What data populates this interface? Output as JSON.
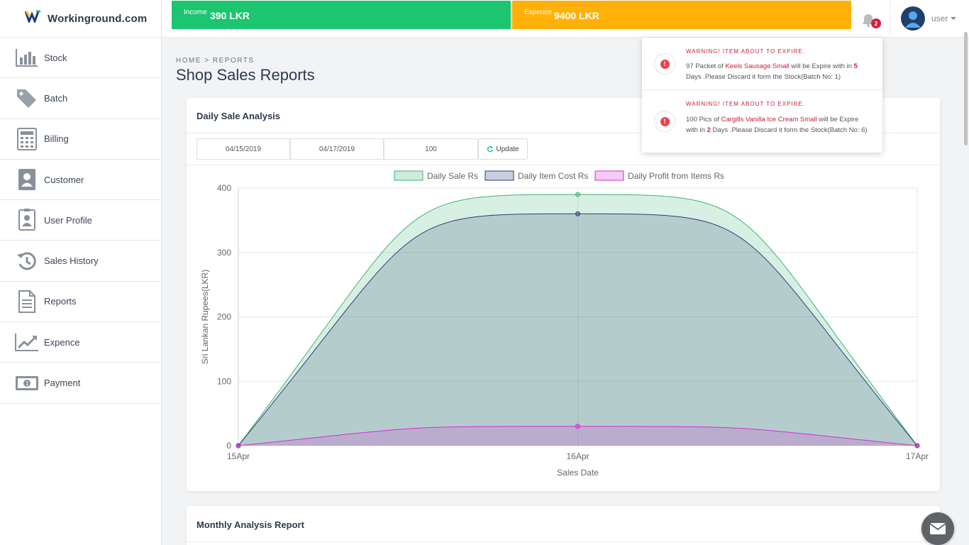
{
  "brand": {
    "name": "Workinground.com"
  },
  "sidebar": {
    "items": [
      {
        "label": "Stock",
        "icon": "bar-chart-icon"
      },
      {
        "label": "Batch",
        "icon": "tags-icon"
      },
      {
        "label": "Billing",
        "icon": "calculator-icon"
      },
      {
        "label": "Customer",
        "icon": "contact-card-icon"
      },
      {
        "label": "User Profile",
        "icon": "id-badge-icon"
      },
      {
        "label": "Sales History",
        "icon": "history-icon"
      },
      {
        "label": "Reports",
        "icon": "document-icon"
      },
      {
        "label": "Expence",
        "icon": "line-chart-icon"
      },
      {
        "label": "Payment",
        "icon": "money-icon"
      }
    ]
  },
  "topbar": {
    "income_label": "Income",
    "income_value": "390 LKR",
    "expence_label": "Expence",
    "expence_value": "9400 LKR",
    "notification_count": "2",
    "user_label": "user",
    "colors": {
      "income": "#1cc56f",
      "expence": "#ffb10a",
      "badge": "#d0213d"
    }
  },
  "breadcrumb": "HOME > REPORTS",
  "page_title": "Shop Sales Reports",
  "daily_card": {
    "title": "Daily Sale Analysis",
    "date_from": "04/15/2019",
    "date_to": "04/17/2019",
    "limit": "100",
    "update_label": "Update"
  },
  "monthly_card": {
    "title": "Monthly Analysis Report"
  },
  "notifications": [
    {
      "title": "WARNING! ITEM ABOUT TO EXPIRE.",
      "qty": "97",
      "unit": "Packet of",
      "item": "Keels Sausage Small",
      "mid": "will be Expire with in",
      "days": "5",
      "tail": "Days .Please Discard it form the Stock(Batch No: 1)"
    },
    {
      "title": "WARNING! ITEM ABOUT TO EXPIRE.",
      "qty": "100",
      "unit": "Pics of",
      "item": "Cargills Vanilla Ice Cream Small",
      "mid": "will be Expire with in",
      "days": "2",
      "tail": "Days .Please Discard it form the Stock(Batch No: 6)"
    }
  ],
  "chart_data": {
    "type": "area",
    "categories": [
      "15Apr",
      "16Apr",
      "17Apr"
    ],
    "series": [
      {
        "name": "Daily Sale Rs",
        "values": [
          0,
          390,
          0
        ],
        "color": "#3cb371"
      },
      {
        "name": "Daily Item Cost Rs",
        "values": [
          0,
          360,
          0
        ],
        "color": "#2f3d7a"
      },
      {
        "name": "Daily Profit from Items Rs",
        "values": [
          0,
          30,
          0
        ],
        "color": "#d42fd4"
      }
    ],
    "xlabel": "Sales Date",
    "ylabel": "Sri Lankan Rupees(LKR)",
    "ylim": [
      0,
      400
    ],
    "yticks": [
      0,
      100,
      200,
      300,
      400
    ],
    "grid": true,
    "legend": "top"
  }
}
